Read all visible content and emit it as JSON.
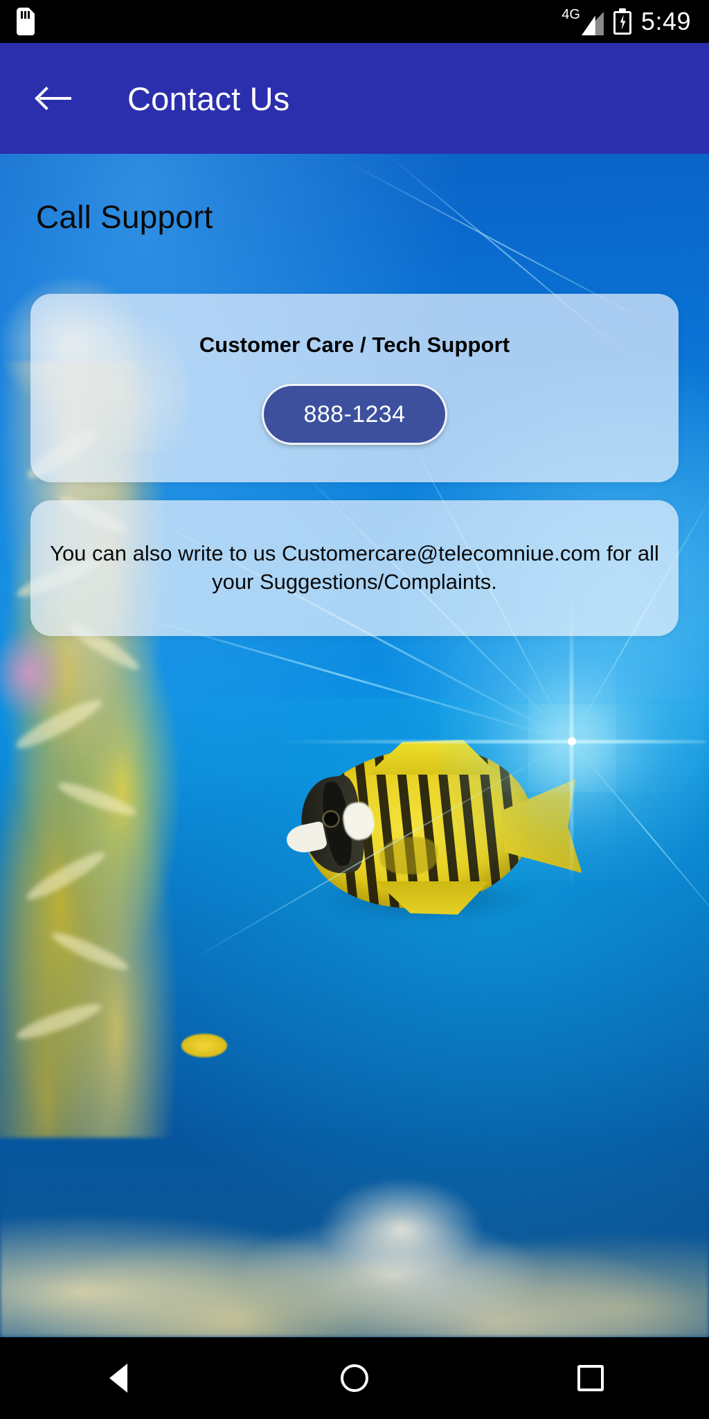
{
  "status_bar": {
    "sd_card_icon": "sd-card-icon",
    "network_label": "4G",
    "signal_icon": "signal-bars-icon",
    "battery_icon": "battery-charging-icon",
    "time": "5:49"
  },
  "app_bar": {
    "back_icon": "arrow-left-icon",
    "title": "Contact Us",
    "background_color": "#2b2fae"
  },
  "page": {
    "title": "Call Support",
    "background": "underwater-coral-reef-photo"
  },
  "call_card": {
    "title": "Customer Care / Tech Support",
    "phone_button": {
      "label": "888-1234",
      "background_color": "#3c509d",
      "text_color": "#ffffff",
      "border_color": "#f2f4f8"
    }
  },
  "email_card": {
    "text": "You can also write to us Customercare@telecomniue.com for all your Suggestions/Complaints.",
    "email": "Customercare@telecomniue.com"
  },
  "nav_bar": {
    "back_icon": "nav-back-triangle-icon",
    "home_icon": "nav-home-circle-icon",
    "recents_icon": "nav-recents-square-icon"
  }
}
